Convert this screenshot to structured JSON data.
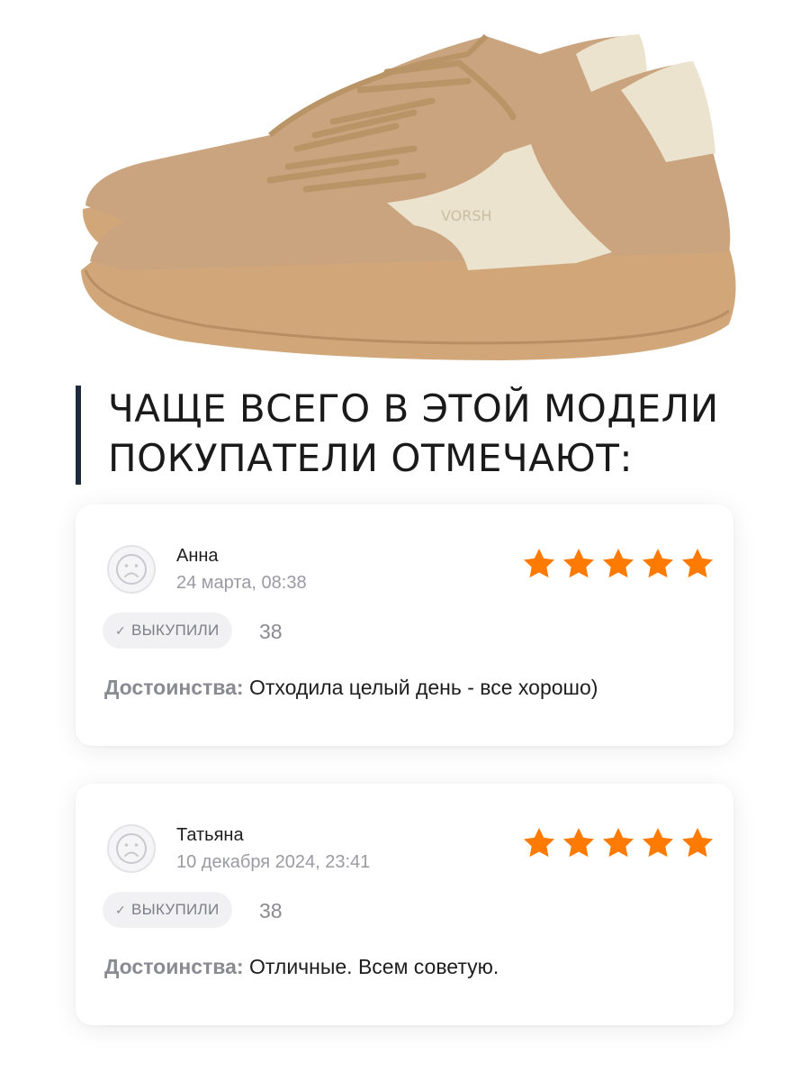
{
  "heading": {
    "line1": "ЧАЩЕ ВСЕГО В ЭТОЙ МОДЕЛИ",
    "line2": "ПОКУПАТЕЛИ ОТМЕЧАЮТ:"
  },
  "product": {
    "brand_text": "VORSH",
    "colors": {
      "suede": "#c9a47e",
      "sole": "#d1a77a",
      "leather": "#ece3cf",
      "lace": "#b99467"
    }
  },
  "colors": {
    "star": "#ff7a00",
    "accent_bar": "#1f2a3c"
  },
  "reviews": [
    {
      "name": "Анна",
      "date": "24 марта, 08:38",
      "rating": 5,
      "badge": "ВЫКУПИЛИ",
      "size": "38",
      "pros_label": "Достоинства:",
      "pros_text": " Отходила целый день - все хорошо)"
    },
    {
      "name": "Татьяна",
      "date": "10 декабря 2024, 23:41",
      "rating": 5,
      "badge": "ВЫКУПИЛИ",
      "size": "38",
      "pros_label": "Достоинства:",
      "pros_text": " Отличные. Всем советую."
    }
  ]
}
